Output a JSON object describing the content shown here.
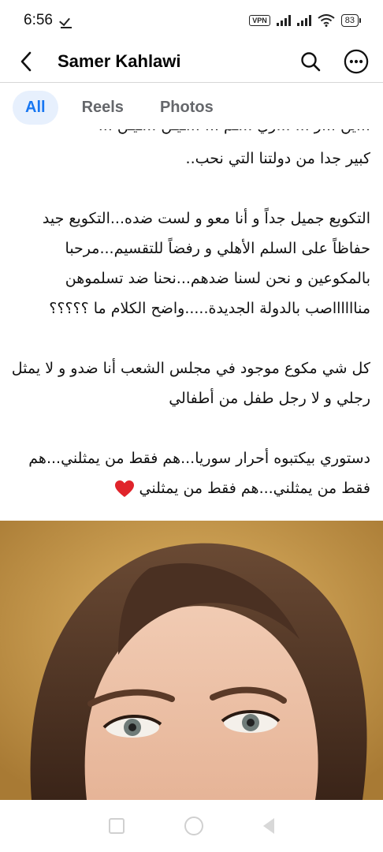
{
  "status_bar": {
    "time": "6:56",
    "vpn_label": "VPN",
    "battery_level": "83"
  },
  "header": {
    "title": "Samer Kahlawi",
    "icons": [
      "back-arrow-icon",
      "search-icon",
      "more-options-icon"
    ]
  },
  "tabs": [
    {
      "label": "All",
      "active": true
    },
    {
      "label": "Reels",
      "active": false
    },
    {
      "label": "Photos",
      "active": false
    }
  ],
  "post": {
    "clipped_line": "...ين ...ر ... ...ري ...ـم ... ...ـيـن ...ـيـن ...",
    "paragraphs": [
      "كبير جدا من دولتنا التي نحب..",
      "التكويع جميل جداً و أنا معو و لست ضده...التكويع جيد حفاظاً على السلم الأهلي و رفضاً للتقسيم...مرحبا بالمكوعين و نحن لسنا ضدهم...نحنا ضد تسلموهن منااااااصب بالدولة الجديدة.....واضح الكلام ما ؟؟؟؟؟",
      "كل شي مكوع موجود في مجلس الشعب أنا ضدو و لا يمثل رجلي و لا رجل طفل من أطفالي",
      "دستوري بيكتبوه أحرار سوريا...هم فقط من يمثلني...هم فقط من يمثلني...هم فقط من يمثلني"
    ],
    "trailing_emoji": "red-heart-icon"
  },
  "colors": {
    "accent": "#1877f2",
    "tab_active_bg": "#e7f0fd",
    "tab_inactive_text": "#65676b",
    "photo_background": "#c89648",
    "heart": "#e0242b"
  }
}
